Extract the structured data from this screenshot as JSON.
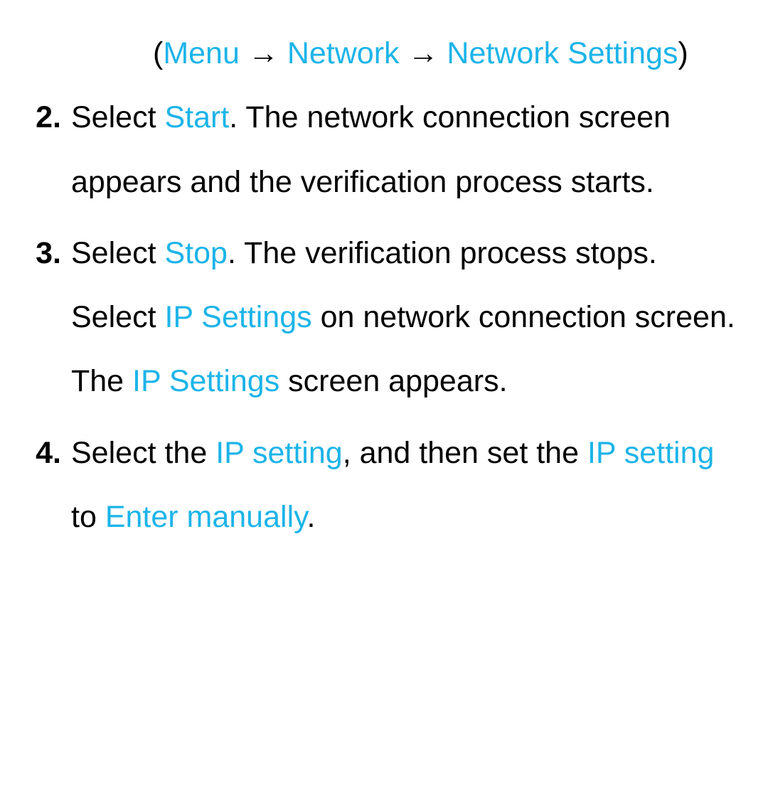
{
  "breadcrumb": {
    "open": "(",
    "item1": "Menu",
    "arrow1": " → ",
    "item2": "Network",
    "arrow2": " → ",
    "item3": "Network Settings",
    "close": ")"
  },
  "list": {
    "num2": "2.",
    "step2_t1": "Select ",
    "step2_k1": "Start",
    "step2_t2": ". The network connection screen appears and the verification process starts.",
    "num3": "3.",
    "step3_t1": "Select ",
    "step3_k1": "Stop",
    "step3_t2": ". The verification process stops. Select ",
    "step3_k2": "IP Settings",
    "step3_t3": " on network connection screen. The ",
    "step3_k3": "IP Settings",
    "step3_t4": " screen appears.",
    "num4": "4.",
    "step4_t1": "Select the ",
    "step4_k1": "IP setting",
    "step4_t2": ", and then set the ",
    "step4_k2": "IP setting",
    "step4_t3": " to ",
    "step4_k3": "Enter manually",
    "step4_t4": "."
  }
}
